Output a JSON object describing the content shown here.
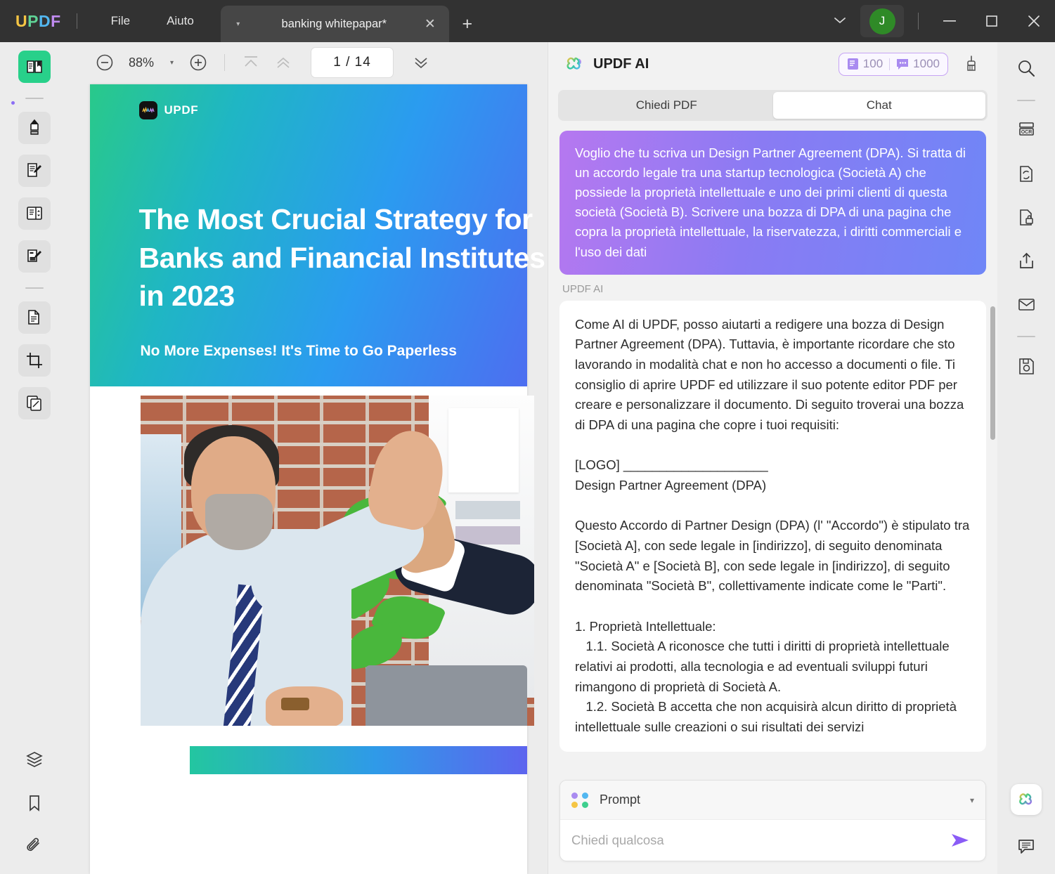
{
  "titlebar": {
    "logo_letters": [
      "U",
      "P",
      "D",
      "F"
    ],
    "menus": [
      {
        "label": "File",
        "name": "menu-file"
      },
      {
        "label": "Aiuto",
        "name": "menu-aiuto"
      }
    ],
    "tab": {
      "title": "banking whitepapar*",
      "caret": "▾",
      "close": "✕"
    },
    "new_tab": "+",
    "chevron_down": "⌄",
    "avatar_initial": "J",
    "window_minimize": "—",
    "window_maximize": "▢",
    "window_close": "✕"
  },
  "left_rail": {
    "items": [
      {
        "name": "sidebar-reader-icon",
        "label": "Reader",
        "active": true
      },
      {
        "name": "sidebar-highlight-icon",
        "label": "Annota"
      },
      {
        "name": "sidebar-edit-pdf-icon",
        "label": "Modifica PDF"
      },
      {
        "name": "sidebar-page-edit-icon",
        "label": "Pagina"
      },
      {
        "name": "sidebar-form-icon",
        "label": "Modulo"
      },
      {
        "name": "sidebar-convert-doc-icon",
        "label": "Converti"
      },
      {
        "name": "sidebar-crop-icon",
        "label": "Ritaglia"
      },
      {
        "name": "sidebar-organize-icon",
        "label": "Organizza"
      }
    ],
    "bottom_items": [
      {
        "name": "sidebar-layers-icon",
        "label": "Livelli"
      },
      {
        "name": "sidebar-bookmark-icon",
        "label": "Segnalibri"
      },
      {
        "name": "sidebar-attachment-icon",
        "label": "Allegati"
      }
    ]
  },
  "viewer": {
    "zoom_out": "−",
    "zoom_level": "88%",
    "zoom_caret": "▾",
    "zoom_in": "+",
    "page_indicator": "1 / 14",
    "current_page": "1",
    "total_pages": "14"
  },
  "pdf": {
    "brand": "UPDF",
    "title": "The Most Crucial Strategy for Banks and Financial Institutes in 2023",
    "subtitle": "No More Expenses! It's Time to Go Paperless"
  },
  "ai": {
    "title": "UPDF AI",
    "credits": {
      "doc_count": "100",
      "chat_count": "1000"
    },
    "tabs": [
      {
        "label": "Chiedi PDF",
        "name": "tab-chiedi-pdf",
        "active": false
      },
      {
        "label": "Chat",
        "name": "tab-chat",
        "active": true
      }
    ],
    "user_message": "Voglio che tu scriva un Design Partner Agreement (DPA). Si tratta di un accordo legale tra una startup tecnologica (Società A) che possiede la proprietà intellettuale e uno dei primi clienti di questa società (Società B). Scrivere una bozza di DPA di una pagina che copra la proprietà intellettuale, la riservatezza, i diritti commerciali e l'uso dei dati",
    "assistant_label": "UPDF AI",
    "assistant_message": "Come AI di UPDF, posso aiutarti a redigere una bozza di Design Partner Agreement (DPA). Tuttavia, è importante ricordare che sto lavorando in modalità chat e non ho accesso a documenti o file. Ti consiglio di aprire UPDF ed utilizzare il suo potente editor PDF per creare e personalizzare il documento. Di seguito troverai una bozza di DPA di una pagina che copre i tuoi requisiti:\n\n[LOGO] ____________________\nDesign Partner Agreement (DPA)\n\nQuesto Accordo di Partner Design (DPA) (l' \"Accordo\") è stipulato tra [Società A], con sede legale in [indirizzo], di seguito denominata \"Società A\" e [Società B], con sede legale in [indirizzo], di seguito denominata \"Società B\", collettivamente indicate come le \"Parti\".\n\n1. Proprietà Intellettuale:\n   1.1. Società A riconosce che tutti i diritti di proprietà intellettuale relativi ai prodotti, alla tecnologia e ad eventuali sviluppi futuri rimangono di proprietà di Società A.\n   1.2. Società B accetta che non acquisirà alcun diritto di proprietà intellettuale sulle creazioni o sui risultati dei servizi",
    "composer": {
      "prompt_label": "Prompt",
      "prompt_caret": "▾",
      "input_placeholder": "Chiedi qualcosa",
      "input_value": ""
    }
  },
  "right_rail": {
    "items": [
      {
        "name": "search-icon",
        "label": "Cerca"
      },
      {
        "name": "ocr-icon",
        "label": "OCR"
      },
      {
        "name": "convert-icon",
        "label": "Converti"
      },
      {
        "name": "protect-icon",
        "label": "Proteggi"
      },
      {
        "name": "share-icon",
        "label": "Condividi"
      },
      {
        "name": "email-icon",
        "label": "Email"
      },
      {
        "name": "save-icon",
        "label": "Salva"
      }
    ],
    "bottom_items": [
      {
        "name": "ai-assistant-icon",
        "label": "UPDF AI"
      },
      {
        "name": "comment-icon",
        "label": "Commenti"
      }
    ]
  },
  "colors": {
    "accent_purple": "#8a7bf3",
    "accent_green": "#28d08a",
    "titlebar_bg": "#323232",
    "panel_bg": "#f2f2f2"
  }
}
